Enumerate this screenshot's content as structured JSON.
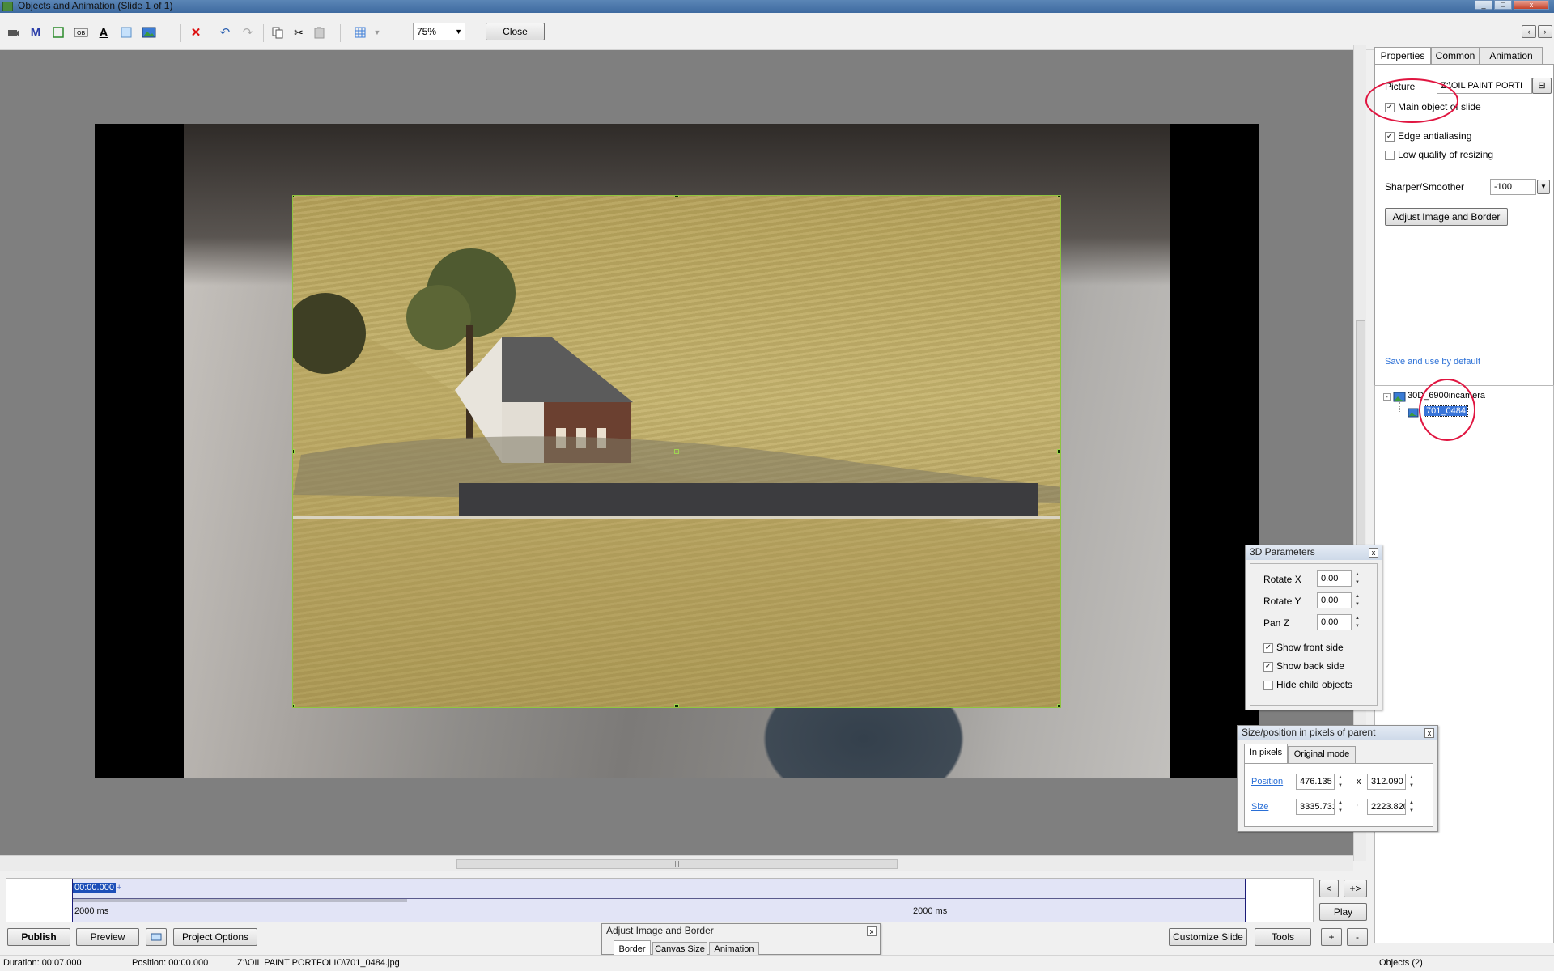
{
  "window": {
    "title": "Objects and Animation  (Slide 1 of 1)"
  },
  "toolbar": {
    "zoom": "75%",
    "close_label": "Close",
    "icons": [
      "camera-icon",
      "text-m-icon",
      "rectangle-icon",
      "button-icon",
      "text-a-icon",
      "frame-icon",
      "image-icon",
      "delete-icon",
      "undo-icon",
      "redo-icon",
      "copy-icon",
      "cut-icon",
      "paste-icon",
      "grid-icon"
    ]
  },
  "properties": {
    "tabs": [
      "Properties",
      "Common",
      "Animation"
    ],
    "picture_label": "Picture",
    "picture_value": "Z:\\OIL PAINT PORTI",
    "main_object": {
      "label": "Main object of slide",
      "checked": true
    },
    "edge_antialiasing": {
      "label": "Edge antialiasing",
      "checked": true
    },
    "low_quality": {
      "label": "Low quality of resizing",
      "checked": false
    },
    "sharper_label": "Sharper/Smoother",
    "sharper_value": "-100",
    "adjust_button": "Adjust Image and Border",
    "save_default": "Save and use by default"
  },
  "tree": {
    "root": "30D_6900incamera",
    "child": "701_0484"
  },
  "params3d": {
    "title": "3D Parameters",
    "rotate_x_label": "Rotate X",
    "rotate_x": "0.00",
    "rotate_y_label": "Rotate Y",
    "rotate_y": "0.00",
    "pan_z_label": "Pan Z",
    "pan_z": "0.00",
    "show_front": "Show front side",
    "show_back": "Show back side",
    "hide_child": "Hide child objects"
  },
  "sizepos": {
    "title": "Size/position in pixels of parent",
    "tabs": [
      "In pixels",
      "Original mode"
    ],
    "position_label": "Position",
    "pos_x": "476.135",
    "pos_sep": "x",
    "pos_y": "312.090",
    "size_label": "Size",
    "size_w": "3335.731",
    "size_h": "2223.820"
  },
  "timeline": {
    "start": "00:00.000",
    "left_ms": "2000 ms",
    "right_ms": "2000 ms",
    "plus": "+",
    "nav_prev": "<",
    "nav_next": "+>",
    "play": "Play"
  },
  "bottom": {
    "publish": "Publish",
    "preview": "Preview",
    "project_options": "Project Options",
    "customize_slide": "Customize Slide",
    "tools": "Tools",
    "plus": "+",
    "minus": "-"
  },
  "adjust_panel": {
    "title": "Adjust Image and Border",
    "tabs": [
      "Border",
      "Canvas Size",
      "Animation"
    ]
  },
  "status": {
    "duration": "Duration:  00:07.000",
    "position": "Position:  00:00.000",
    "path": "Z:\\OIL PAINT PORTFOLIO\\701_0484.jpg",
    "objects": "Objects (2)"
  }
}
